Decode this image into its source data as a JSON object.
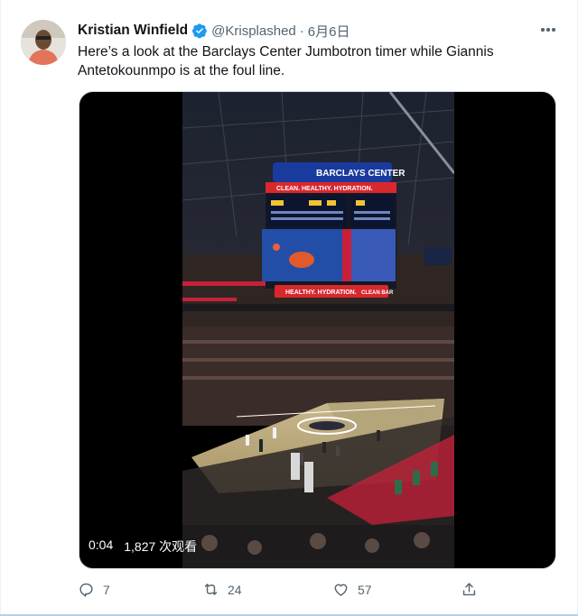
{
  "tweet": {
    "author_name": "Kristian Winfield",
    "handle": "@Krisplashed",
    "separator": "·",
    "date": "6月6日",
    "text": "Here’s a look at the Barclays Center Jumbotron timer while Giannis Antetokounmpo is at the foul line."
  },
  "video": {
    "elapsed": "0:04",
    "views": "1,827 次观看",
    "board_top_text": "BARCLAYS CENTER",
    "board_band_text": "CLEAN. HEALTHY. HYDRATION.",
    "board_lower_text": "HEALTHY. HYDRATION.",
    "board_side_text": "CLEAN BAR"
  },
  "actions": {
    "reply_count": "7",
    "retweet_count": "24",
    "like_count": "57"
  },
  "icons": {
    "verified": "verified-badge-icon",
    "more": "more-dots-icon",
    "reply": "reply-icon",
    "retweet": "retweet-icon",
    "like": "heart-icon",
    "share": "share-icon"
  },
  "colors": {
    "verified_blue": "#1d9bf0",
    "secondary_text": "#536471",
    "primary_text": "#0f1419"
  }
}
